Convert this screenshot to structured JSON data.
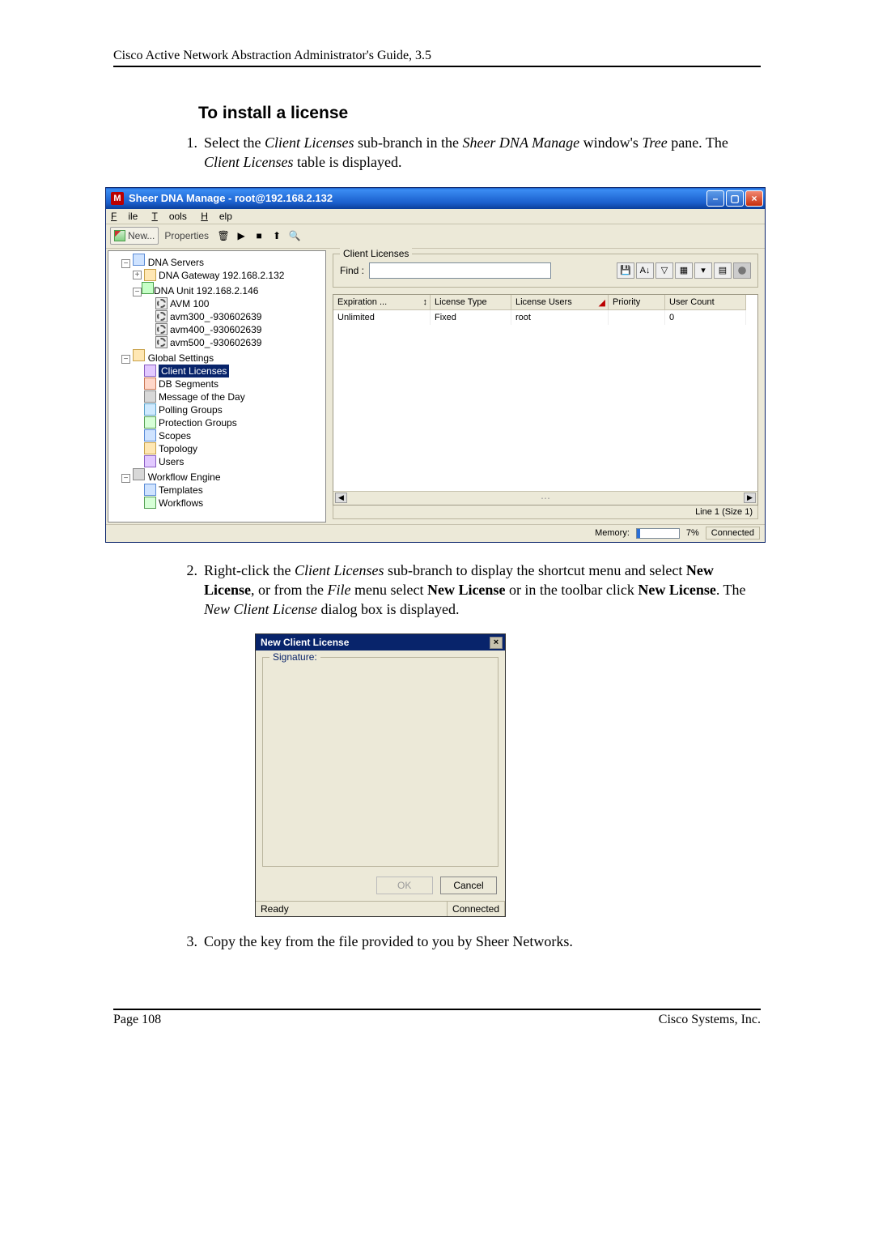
{
  "header_running": "Cisco Active Network Abstraction Administrator's Guide, 3.5",
  "section_title": "To install a license",
  "steps": {
    "s1": {
      "num": "1.",
      "p1a": "Select the ",
      "p1b": "Client Licenses",
      "p1c": " sub-branch in the ",
      "p1d": "Sheer DNA Manage",
      "p1e": " window's ",
      "p1f": "Tree",
      "p1g": " pane. The ",
      "p1h": "Client Licenses",
      "p1i": " table is displayed."
    },
    "s2": {
      "num": "2.",
      "t1": "Right-click the ",
      "t2": "Client Licenses",
      "t3": " sub-branch to display the shortcut menu and select ",
      "t4": "New License",
      "t5": ", or from the ",
      "t6": "File",
      "t7": " menu select ",
      "t8": "New License",
      "t9": " or in the toolbar click ",
      "t10": "New License",
      "t11": ". The ",
      "t12": "New Client License",
      "t13": " dialog box is displayed."
    },
    "s3": {
      "num": "3.",
      "text": "Copy the key from the file provided to you by Sheer Networks."
    }
  },
  "win1": {
    "title": "Sheer DNA Manage - root@192.168.2.132",
    "menus": {
      "file": "File",
      "tools": "Tools",
      "help": "Help"
    },
    "toolbar": {
      "new": "New...",
      "properties": "Properties"
    },
    "tree": {
      "dna_servers": "DNA Servers",
      "gateway": "DNA Gateway 192.168.2.132",
      "unit": "DNA Unit 192.168.2.146",
      "avm100": "AVM 100",
      "avm300": "avm300_-930602639",
      "avm400": "avm400_-930602639",
      "avm500": "avm500_-930602639",
      "global": "Global Settings",
      "client_licenses": "Client Licenses",
      "db": "DB Segments",
      "motd": "Message of the Day",
      "polling": "Polling Groups",
      "protection": "Protection Groups",
      "scopes": "Scopes",
      "topology": "Topology",
      "users": "Users",
      "we": "Workflow Engine",
      "templates": "Templates",
      "workflows": "Workflows"
    },
    "right": {
      "legend": "Client Licenses",
      "find_label": "Find :",
      "find_value": "",
      "columns": {
        "c1": "Expiration ...",
        "c2": "License Type",
        "c3": "License Users",
        "c4": "Priority",
        "c5": "User Count"
      },
      "row1": {
        "c1": "Unlimited",
        "c2": "Fixed",
        "c3": "root",
        "c4": "",
        "c5": "0"
      },
      "line_info": "Line 1 (Size 1)"
    },
    "status": {
      "memory_label": "Memory:",
      "memory_pct": "7%",
      "connected": "Connected"
    }
  },
  "dlg": {
    "title": "New Client License",
    "signature_legend": "Signature:",
    "ok": "OK",
    "cancel": "Cancel",
    "ready": "Ready",
    "connected": "Connected"
  },
  "footer": {
    "left": "Page 108",
    "right": "Cisco Systems, Inc."
  }
}
